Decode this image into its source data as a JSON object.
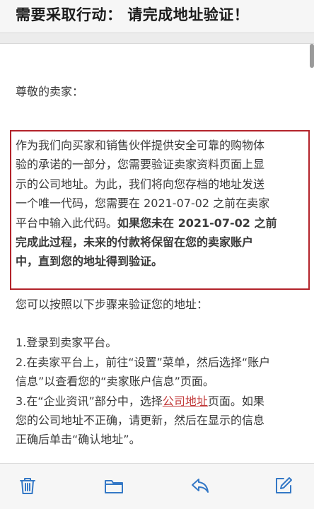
{
  "header": {
    "title": "需要采取行动： 请完成地址验证！"
  },
  "email": {
    "greeting": "尊敬的卖家：",
    "notice_lines": [
      "作为我们向买家和销售伙伴提供安全可靠的购物体",
      "验的承诺的一部分，您需要验证卖家资料页面上显",
      "示的公司地址。为此，我们将向您存档的地址发送",
      "一个唯一代码，您需要在 2021-07-02 之前在卖家",
      "平台中输入此代码。"
    ],
    "notice_bold_inline": "如果您未在 2021-07-02 之前",
    "notice_bold_lines": [
      "完成此过程，未来的付款将保留在您的卖家账户",
      "中，直到您的地址得到验证。"
    ],
    "steps_intro": "您可以按照以下步骤来验证您的地址：",
    "step1": "1.登录到卖家平台。",
    "step2_line1": "2.在卖家平台上，前往“设置”菜单，然后选择“账户",
    "step2_line2": "信息”以查看您的“卖家账户信息”页面。",
    "step3_prefix": "3.在“企业资讯”部分中，选择",
    "step3_link": "公司地址",
    "step3_suffix": "页面。如果",
    "step3_line2": "您的公司地址不正确，请更新，然后在显示的信息",
    "step3_line3": "正确后单击“确认地址”。"
  },
  "toolbar": {
    "icons": [
      "trash-icon",
      "folder-icon",
      "reply-icon",
      "compose-icon"
    ],
    "color": "#3478c6"
  },
  "colors": {
    "notice_border": "#b3232a",
    "link": "#c23b3b"
  }
}
